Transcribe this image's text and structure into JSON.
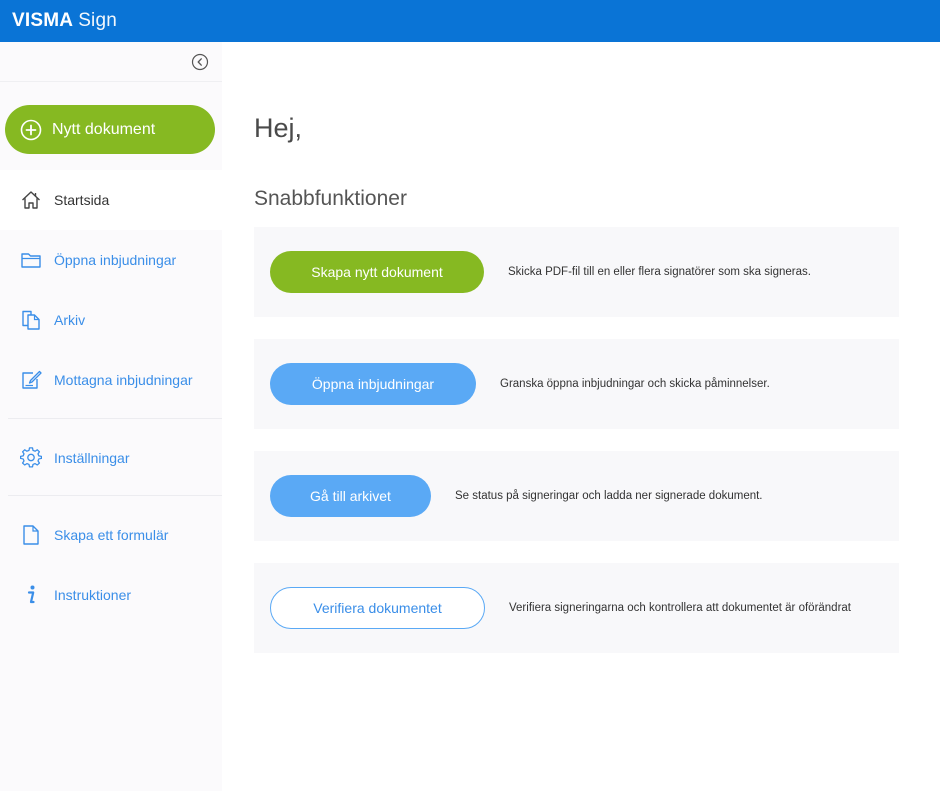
{
  "app": {
    "brand_bold": "VISMA",
    "brand_light": "Sign"
  },
  "colors": {
    "topbar": "#0a74d6",
    "green": "#86b922",
    "blue": "#5aa9f5",
    "link": "#3a8ee8"
  },
  "sidebar": {
    "collapse_icon": "chevron-left-circle-icon",
    "new_document_label": "Nytt dokument",
    "items": [
      {
        "label": "Startsida",
        "icon": "home-icon"
      },
      {
        "label": "Öppna inbjudningar",
        "icon": "folder-icon"
      },
      {
        "label": "Arkiv",
        "icon": "archive-icon"
      },
      {
        "label": "Mottagna inbjudningar",
        "icon": "edit-icon"
      },
      {
        "label": "Inställningar",
        "icon": "gear-icon"
      },
      {
        "label": "Skapa ett formulär",
        "icon": "document-icon"
      },
      {
        "label": "Instruktioner",
        "icon": "info-icon"
      }
    ]
  },
  "main": {
    "greeting": "Hej,",
    "section_title": "Snabbfunktioner",
    "cards": [
      {
        "button": "Skapa nytt dokument",
        "desc": "Skicka PDF-fil till en eller flera signatörer som ska signeras."
      },
      {
        "button": "Öppna inbjudningar",
        "desc": "Granska öppna inbjudningar och skicka påminnelser."
      },
      {
        "button": "Gå till arkivet",
        "desc": "Se status på signeringar och ladda ner signerade dokument."
      },
      {
        "button": "Verifiera dokumentet",
        "desc": "Verifiera signeringarna och kontrollera att dokumentet är oförändrat"
      }
    ]
  }
}
